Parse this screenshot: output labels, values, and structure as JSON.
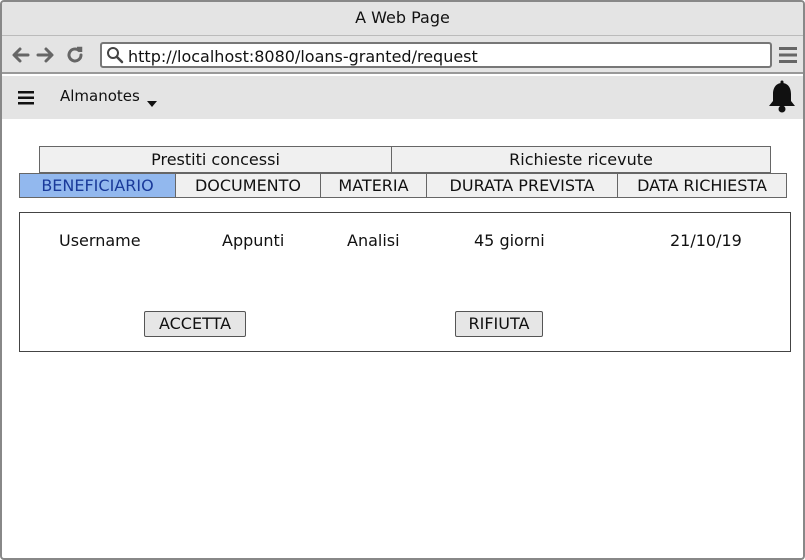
{
  "window": {
    "title": "A Web Page"
  },
  "browser": {
    "url": "http://localhost:8080/loans-granted/request"
  },
  "app": {
    "name": "Almanotes"
  },
  "tabs": [
    "Prestiti concessi",
    "Richieste ricevute"
  ],
  "columns": [
    {
      "label": "BENEFICIARIO",
      "active": true
    },
    {
      "label": "DOCUMENTO",
      "active": false
    },
    {
      "label": "MATERIA",
      "active": false
    },
    {
      "label": "DURATA PREVISTA",
      "active": false
    },
    {
      "label": "DATA RICHIESTA",
      "active": false
    }
  ],
  "request": {
    "beneficiary": "Username",
    "document": "Appunti",
    "subject": "Analisi",
    "duration": "45 giorni",
    "date": "21/10/19"
  },
  "actions": {
    "accept": "ACCETTA",
    "reject": "RIFIUTA"
  },
  "colors": {
    "active_column": "#92b8ee",
    "chrome": "#e4e4e4"
  }
}
